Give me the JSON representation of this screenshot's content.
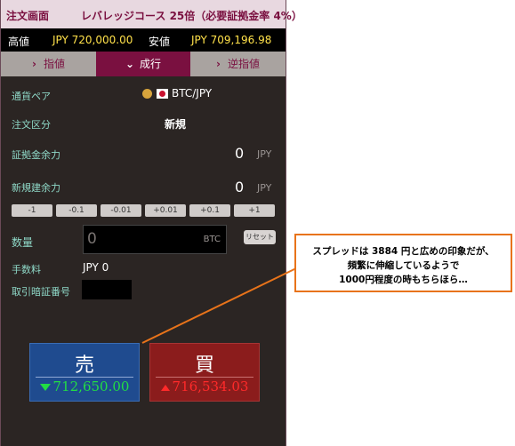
{
  "titlebar": {
    "title": "注文画面",
    "course": "レバレッジコース 25倍（必要証拠金率 4%）"
  },
  "prices": {
    "high_label": "高値",
    "high_value": "JPY 720,000.00",
    "low_label": "安値",
    "low_value": "JPY 709,196.98"
  },
  "tabs": [
    {
      "label": "指値",
      "icon": "chevron-right-icon"
    },
    {
      "label": "成行",
      "icon": "chevron-down-icon"
    },
    {
      "label": "逆指値",
      "icon": "chevron-right-icon"
    }
  ],
  "form": {
    "pair_label": "通貨ペア",
    "pair_value": "BTC/JPY",
    "type_label": "注文区分",
    "type_value": "新規",
    "margin_label": "証拠金余力",
    "margin_value": "0",
    "margin_unit": "JPY",
    "newpos_label": "新規建余力",
    "newpos_value": "0",
    "newpos_unit": "JPY",
    "steps": [
      "-1",
      "-0.1",
      "-0.01",
      "+0.01",
      "+0.1",
      "+1"
    ],
    "qty_label": "数量",
    "qty_placeholder": "0",
    "qty_unit": "BTC",
    "reset_label": "リセット",
    "fee_label": "手数料",
    "fee_value": "JPY 0",
    "pin_label": "取引暗証番号"
  },
  "orders": {
    "sell_label": "売",
    "sell_price": "712,650.00",
    "buy_label": "買",
    "buy_price": "716,534.03"
  },
  "callout": {
    "line1": "スプレッドは 3884 円と広めの印象だが、",
    "line2": "頻繁に伸縮しているようで",
    "line3": "1000円程度の時もちらほら…"
  },
  "colors": {
    "accent": "#7a1040",
    "price_yellow": "#ffe14a",
    "sell_green": "#22dd44",
    "buy_red": "#ff2a2a",
    "callout_border": "#e8731a"
  }
}
